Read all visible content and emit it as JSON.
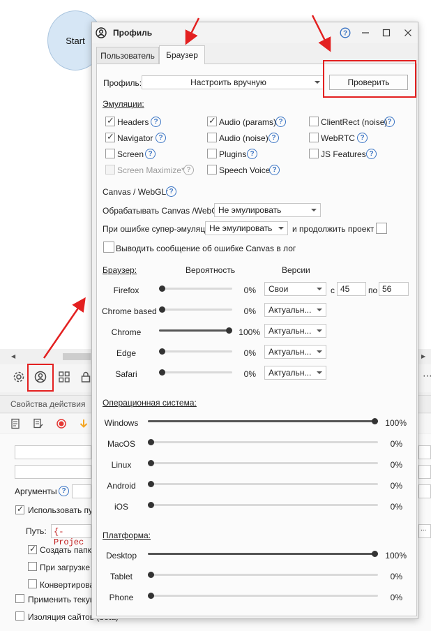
{
  "background": {
    "start_node": "Start",
    "props_title": "Свойства действия",
    "arguments_label": "Аргументы",
    "use_path_label": "Использовать пут",
    "path_label": "Путь:",
    "path_value": "{-Projec",
    "create_folder_label": "Создать папку",
    "on_load_label": "При загрузке",
    "convert_label": "Конвертирова",
    "apply_current_label": "Применить текущ",
    "site_isolation_label": "Изоляция сайтов (beta)",
    "toolbar_more": "⋯"
  },
  "dialog": {
    "title": "Профиль",
    "tabs": {
      "user": "Пользователь",
      "browser": "Браузер"
    },
    "profile": {
      "label": "Профиль:",
      "value": "Настроить вручную",
      "check_button": "Проверить"
    },
    "emulation": {
      "title": "Эмуляции:",
      "items": [
        {
          "label": "Headers",
          "checked": true
        },
        {
          "label": "Navigator",
          "checked": true
        },
        {
          "label": "Screen",
          "checked": false
        },
        {
          "label": "Screen Maximize*",
          "checked": false,
          "disabled": true
        },
        {
          "label": "Audio (params)",
          "checked": true
        },
        {
          "label": "Audio (noise)",
          "checked": false
        },
        {
          "label": "Plugins",
          "checked": false
        },
        {
          "label": "Speech Voice",
          "checked": false
        },
        {
          "label": "ClientRect (noise)",
          "checked": false
        },
        {
          "label": "WebRTC",
          "checked": false
        },
        {
          "label": "JS Features",
          "checked": false
        }
      ]
    },
    "canvas": {
      "title": "Canvas / WebGL:",
      "process_label": "Обрабатывать Canvas /WebGL",
      "process_value": "Не эмулировать",
      "error_label": "При ошибке супер-эмуляции",
      "error_value": "Не эмулировать",
      "continue_label": "и продолжить проект",
      "log_label": "Выводить сообщение об ошибке Canvas в лог"
    },
    "browser": {
      "title": "Браузер:",
      "prob_header": "Вероятность",
      "versions_header": "Версии",
      "rows": [
        {
          "name": "Firefox",
          "pct": 0,
          "pct_label": "0%",
          "version": "Свои",
          "from_label": "с",
          "from": "45",
          "to_label": "по",
          "to": "56"
        },
        {
          "name": "Chrome based",
          "pct": 0,
          "pct_label": "0%",
          "version": "Актуальн..."
        },
        {
          "name": "Chrome",
          "pct": 100,
          "pct_label": "100%",
          "version": "Актуальн..."
        },
        {
          "name": "Edge",
          "pct": 0,
          "pct_label": "0%",
          "version": "Актуальн..."
        },
        {
          "name": "Safari",
          "pct": 0,
          "pct_label": "0%",
          "version": "Актуальн..."
        }
      ]
    },
    "os": {
      "title": "Операционная система:",
      "rows": [
        {
          "name": "Windows",
          "pct": 100,
          "pct_label": "100%"
        },
        {
          "name": "MacOS",
          "pct": 0,
          "pct_label": "0%"
        },
        {
          "name": "Linux",
          "pct": 0,
          "pct_label": "0%"
        },
        {
          "name": "Android",
          "pct": 0,
          "pct_label": "0%"
        },
        {
          "name": "iOS",
          "pct": 0,
          "pct_label": "0%"
        }
      ]
    },
    "platform": {
      "title": "Платформа:",
      "rows": [
        {
          "name": "Desktop",
          "pct": 100,
          "pct_label": "100%"
        },
        {
          "name": "Tablet",
          "pct": 0,
          "pct_label": "0%"
        },
        {
          "name": "Phone",
          "pct": 0,
          "pct_label": "0%"
        }
      ]
    }
  },
  "colors": {
    "annotation": "#e32020",
    "help": "#3a74c4",
    "record": "#e53935",
    "down_arrow": "#f5a623"
  }
}
